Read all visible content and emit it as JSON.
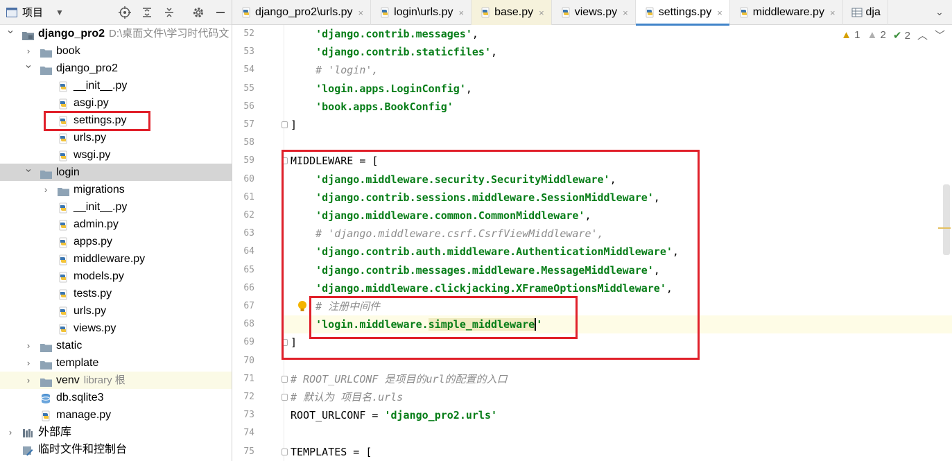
{
  "project": {
    "title": "项目",
    "tree": [
      {
        "indent": 0,
        "arrow": "▾",
        "icon": "module",
        "label": "django_pro2",
        "extra": "D:\\桌面文件\\学习时代码文",
        "bold": true
      },
      {
        "indent": 1,
        "arrow": "›",
        "icon": "folder",
        "label": "book"
      },
      {
        "indent": 1,
        "arrow": "▾",
        "icon": "folder",
        "label": "django_pro2"
      },
      {
        "indent": 2,
        "icon": "py",
        "label": "__init__.py"
      },
      {
        "indent": 2,
        "icon": "py",
        "label": "asgi.py"
      },
      {
        "indent": 2,
        "icon": "py",
        "label": "settings.py"
      },
      {
        "indent": 2,
        "icon": "py",
        "label": "urls.py"
      },
      {
        "indent": 2,
        "icon": "py",
        "label": "wsgi.py"
      },
      {
        "indent": 1,
        "arrow": "▾",
        "icon": "folder",
        "label": "login",
        "selected": true
      },
      {
        "indent": 2,
        "arrow": "›",
        "icon": "folder",
        "label": "migrations"
      },
      {
        "indent": 2,
        "icon": "py",
        "label": "__init__.py"
      },
      {
        "indent": 2,
        "icon": "py",
        "label": "admin.py"
      },
      {
        "indent": 2,
        "icon": "py",
        "label": "apps.py"
      },
      {
        "indent": 2,
        "icon": "py",
        "label": "middleware.py"
      },
      {
        "indent": 2,
        "icon": "py",
        "label": "models.py"
      },
      {
        "indent": 2,
        "icon": "py",
        "label": "tests.py"
      },
      {
        "indent": 2,
        "icon": "py",
        "label": "urls.py"
      },
      {
        "indent": 2,
        "icon": "py",
        "label": "views.py"
      },
      {
        "indent": 1,
        "arrow": "›",
        "icon": "folder",
        "label": "static"
      },
      {
        "indent": 1,
        "arrow": "›",
        "icon": "folder",
        "label": "template"
      },
      {
        "indent": 1,
        "arrow": "›",
        "icon": "folder",
        "label": "venv",
        "extra": "library 根",
        "venv": true
      },
      {
        "indent": 1,
        "icon": "db",
        "label": "db.sqlite3"
      },
      {
        "indent": 1,
        "icon": "py",
        "label": "manage.py"
      },
      {
        "indent": 0,
        "arrow": "›",
        "icon": "lib",
        "label": "外部库"
      },
      {
        "indent": 0,
        "icon": "scratch",
        "label": "临时文件和控制台"
      }
    ]
  },
  "tabs": [
    {
      "label": "django_pro2\\urls.py",
      "close": "×"
    },
    {
      "label": "login\\urls.py",
      "close": "×"
    },
    {
      "label": "base.py",
      "close": "×",
      "base": true
    },
    {
      "label": "views.py",
      "close": "×"
    },
    {
      "label": "settings.py",
      "close": "×",
      "active": true
    },
    {
      "label": "middleware.py",
      "close": "×"
    },
    {
      "label": "dja",
      "close": "",
      "table": true
    }
  ],
  "inspections": {
    "warnings": "1",
    "weak_warnings": "2",
    "ok": "2"
  },
  "code_lines": [
    {
      "n": "52",
      "parts": [
        [
          "s",
          "    'django.contrib.messages'"
        ],
        [
          "k",
          ","
        ]
      ]
    },
    {
      "n": "53",
      "parts": [
        [
          "s",
          "    'django.contrib.staticfiles'"
        ],
        [
          "k",
          ","
        ]
      ]
    },
    {
      "n": "54",
      "parts": [
        [
          "c",
          "    # 'login',"
        ]
      ]
    },
    {
      "n": "55",
      "parts": [
        [
          "s",
          "    'login.apps.LoginConfig'"
        ],
        [
          "k",
          ","
        ]
      ]
    },
    {
      "n": "56",
      "parts": [
        [
          "s",
          "    'book.apps.BookConfig'"
        ]
      ]
    },
    {
      "n": "57",
      "parts": [
        [
          "k",
          "]"
        ]
      ],
      "fold": true
    },
    {
      "n": "58",
      "parts": []
    },
    {
      "n": "59",
      "parts": [
        [
          "k",
          "MIDDLEWARE = ["
        ]
      ],
      "fold": true
    },
    {
      "n": "60",
      "parts": [
        [
          "s",
          "    'django.middleware.security.SecurityMiddleware'"
        ],
        [
          "k",
          ","
        ]
      ]
    },
    {
      "n": "61",
      "parts": [
        [
          "s",
          "    'django.contrib.sessions.middleware.SessionMiddleware'"
        ],
        [
          "k",
          ","
        ]
      ]
    },
    {
      "n": "62",
      "parts": [
        [
          "s",
          "    'django.middleware.common.CommonMiddleware'"
        ],
        [
          "k",
          ","
        ]
      ]
    },
    {
      "n": "63",
      "parts": [
        [
          "c",
          "    # 'django.middleware.csrf.CsrfViewMiddleware',"
        ]
      ]
    },
    {
      "n": "64",
      "parts": [
        [
          "s",
          "    'django.contrib.auth.middleware.AuthenticationMiddleware'"
        ],
        [
          "k",
          ","
        ]
      ]
    },
    {
      "n": "65",
      "parts": [
        [
          "s",
          "    'django.contrib.messages.middleware.MessageMiddleware'"
        ],
        [
          "k",
          ","
        ]
      ]
    },
    {
      "n": "66",
      "parts": [
        [
          "s",
          "    'django.middleware.clickjacking.XFrameOptionsMiddleware'"
        ],
        [
          "k",
          ","
        ]
      ]
    },
    {
      "n": "67",
      "parts": [
        [
          "c",
          "    # 注册中间件"
        ]
      ]
    },
    {
      "n": "68",
      "parts": [
        [
          "s",
          "    'login.middleware."
        ],
        [
          "sh",
          "simple_middleware"
        ],
        [
          "sc",
          "'"
        ]
      ],
      "current": true
    },
    {
      "n": "69",
      "parts": [
        [
          "k",
          "]"
        ]
      ],
      "fold": true
    },
    {
      "n": "70",
      "parts": []
    },
    {
      "n": "71",
      "parts": [
        [
          "c",
          "# ROOT_URLCONF 是项目的url的配置的入口"
        ]
      ],
      "fold": true
    },
    {
      "n": "72",
      "parts": [
        [
          "c",
          "# 默认为 项目名.urls"
        ]
      ],
      "fold": true
    },
    {
      "n": "73",
      "parts": [
        [
          "k",
          "ROOT_URLCONF = "
        ],
        [
          "s",
          "'django_pro2.urls'"
        ]
      ]
    },
    {
      "n": "74",
      "parts": []
    },
    {
      "n": "75",
      "parts": [
        [
          "k",
          "TEMPLATES = ["
        ]
      ],
      "fold": true
    }
  ],
  "colors": {
    "highlight_box": "#e0202a",
    "string": "#067d17",
    "comment": "#8c8c8c",
    "tab_active_underline": "#4083c9"
  }
}
